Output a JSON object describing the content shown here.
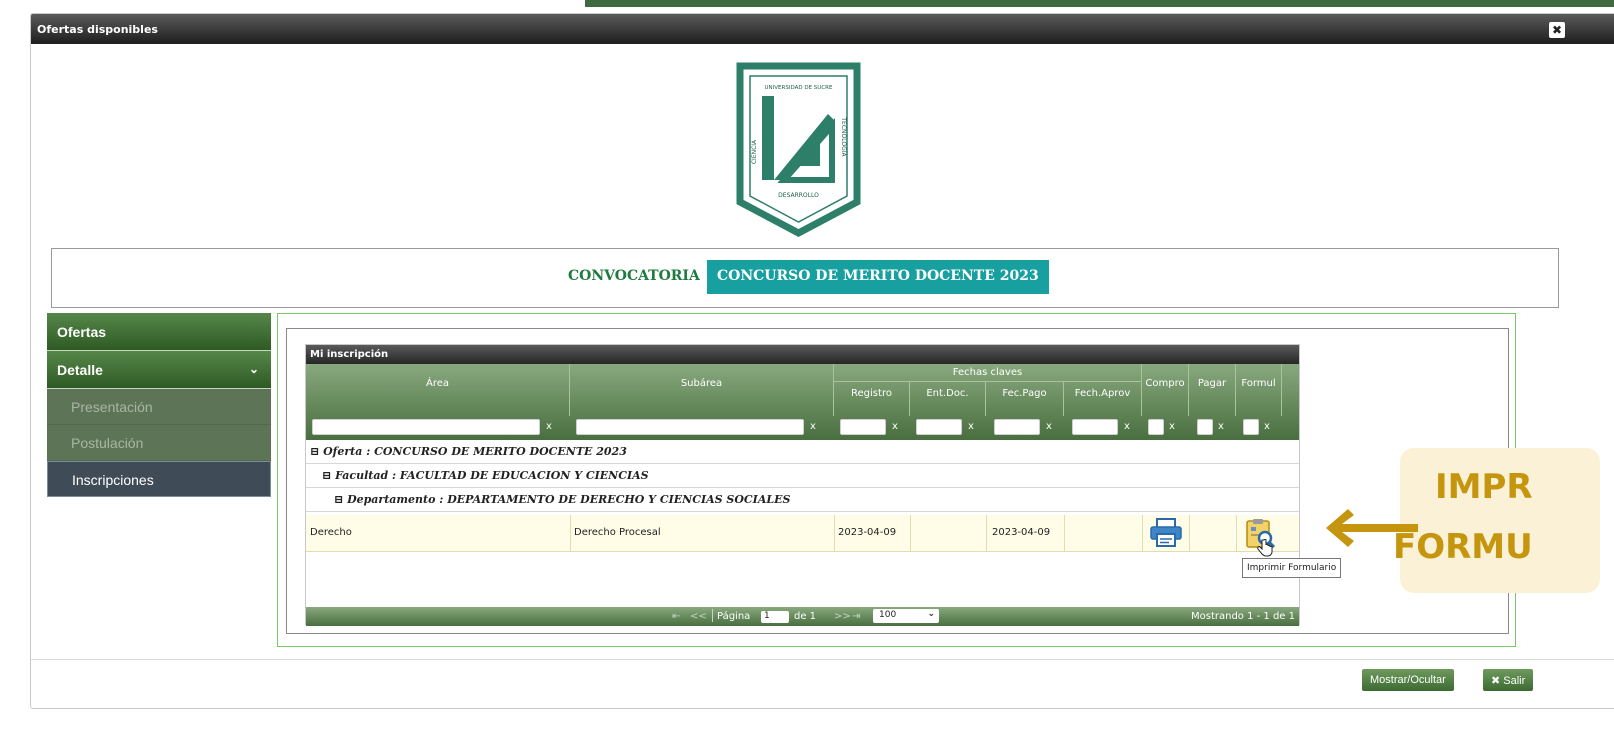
{
  "dialog": {
    "title": "Ofertas disponibles",
    "close_glyph": "✖"
  },
  "logo": {
    "top_text": "UNIVERSIDAD DE SUCRE",
    "left_text": "CIENCIA",
    "right_text": "TECNOLOGÍA",
    "bottom_text": "DESARROLLO",
    "colors": {
      "primary": "#2e7f6a",
      "dark": "#1f5e4c"
    }
  },
  "convocatoria": {
    "label": "CONVOCATORIA",
    "name": "CONCURSO DE MERITO DOCENTE 2023"
  },
  "menu": {
    "items": [
      {
        "label": "Ofertas"
      },
      {
        "label": "Detalle",
        "chevron": "⌄"
      }
    ],
    "subitems": [
      {
        "label": "Presentación"
      },
      {
        "label": "Postulación"
      },
      {
        "label": "Inscripciones"
      }
    ]
  },
  "grid": {
    "caption": "Mi inscripción",
    "columns": {
      "area": "Área",
      "subarea": "Subárea",
      "fechas": "Fechas claves",
      "registro": "Registro",
      "entdoc": "Ent.Doc.",
      "fecpago": "Fec.Pago",
      "fechaprov": "Fech.Aprov",
      "compr": "Compro",
      "pagar": "Pagar",
      "formul": "Formul"
    },
    "filter_clear": "x",
    "groups": {
      "oferta": "Oferta : CONCURSO DE MERITO DOCENTE 2023",
      "facultad": "Facultad : FACULTAD DE EDUCACION Y CIENCIAS",
      "departamento": "Departamento : DEPARTAMENTO DE DERECHO Y CIENCIAS SOCIALES",
      "toggle": "⊟"
    },
    "row": {
      "area": "Derecho",
      "subarea": "Derecho Procesal",
      "registro": "2023-04-09",
      "entdoc": "",
      "fecpago": "2023-04-09",
      "fechaprov": ""
    },
    "pager": {
      "first": "⇤",
      "prev": "<<",
      "page_label": "Página",
      "page_value": "1",
      "of_label": "de 1",
      "next": ">>",
      "last": "⇥",
      "page_size": "100",
      "showing": "Mostrando 1 - 1 de 1"
    }
  },
  "tooltip": {
    "text": "Imprimir Formulario"
  },
  "annotation": {
    "line1": "IMPR",
    "line2": "FORMU",
    "color": "#c4950d"
  },
  "footer": {
    "mostrar": "Mostrar/Ocultar",
    "salir": "Salir"
  }
}
